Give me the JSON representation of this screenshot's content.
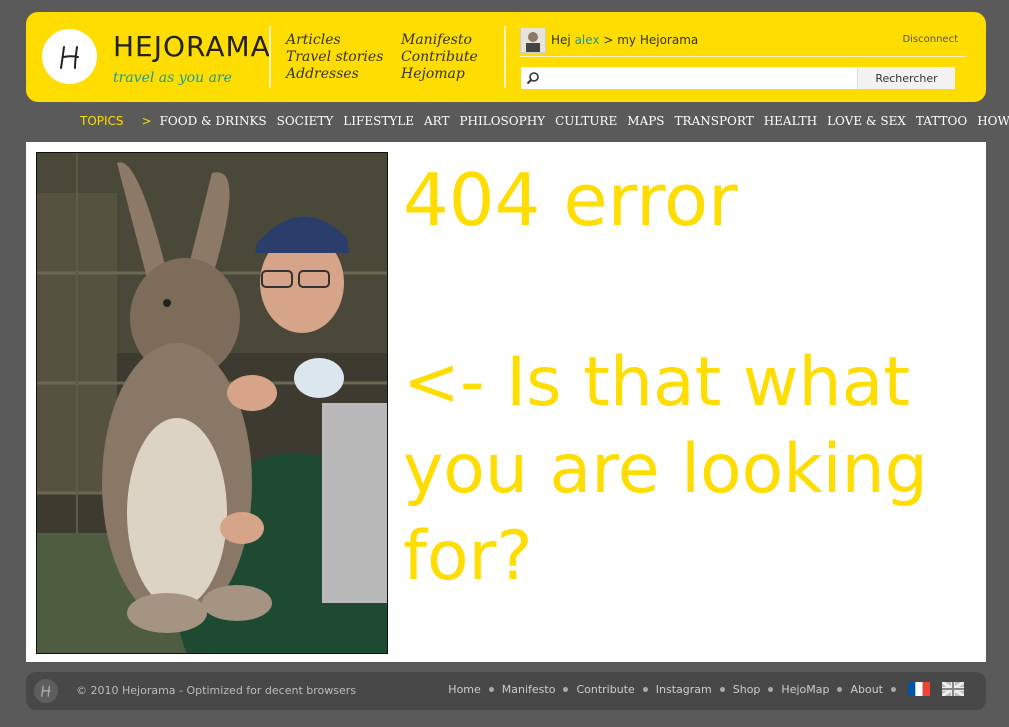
{
  "header": {
    "logo_name": "HEJORAMA",
    "tagline": "travel as you are",
    "nav_left": [
      "Articles",
      "Travel stories",
      "Addresses"
    ],
    "nav_right": [
      "Manifesto",
      "Contribute",
      "Hejomap"
    ],
    "greeting": "Hej",
    "username": "alex",
    "my_link": "> my Hejorama",
    "disconnect": "Disconnect",
    "search_placeholder": "",
    "search_button": "Rechercher"
  },
  "topics": {
    "label": "TOPICS",
    "arrow": ">",
    "items": [
      "FOOD & DRINKS",
      "SOCIETY",
      "LIFESTYLE",
      "ART",
      "PHILOSOPHY",
      "CULTURE",
      "MAPS",
      "TRANSPORT",
      "HEALTH",
      "LOVE & SEX",
      "TATTOO",
      "HOW-TO"
    ]
  },
  "main": {
    "error_title": "404 error",
    "error_message": "<- Is that what you are looking for?",
    "accent_color": "#ffdd00"
  },
  "footer": {
    "copyright": "© 2010 Hejorama - Optimized for decent browsers",
    "links": [
      "Home",
      "Manifesto",
      "Contribute",
      "Instagram",
      "Shop",
      "HejoMap",
      "About"
    ]
  }
}
